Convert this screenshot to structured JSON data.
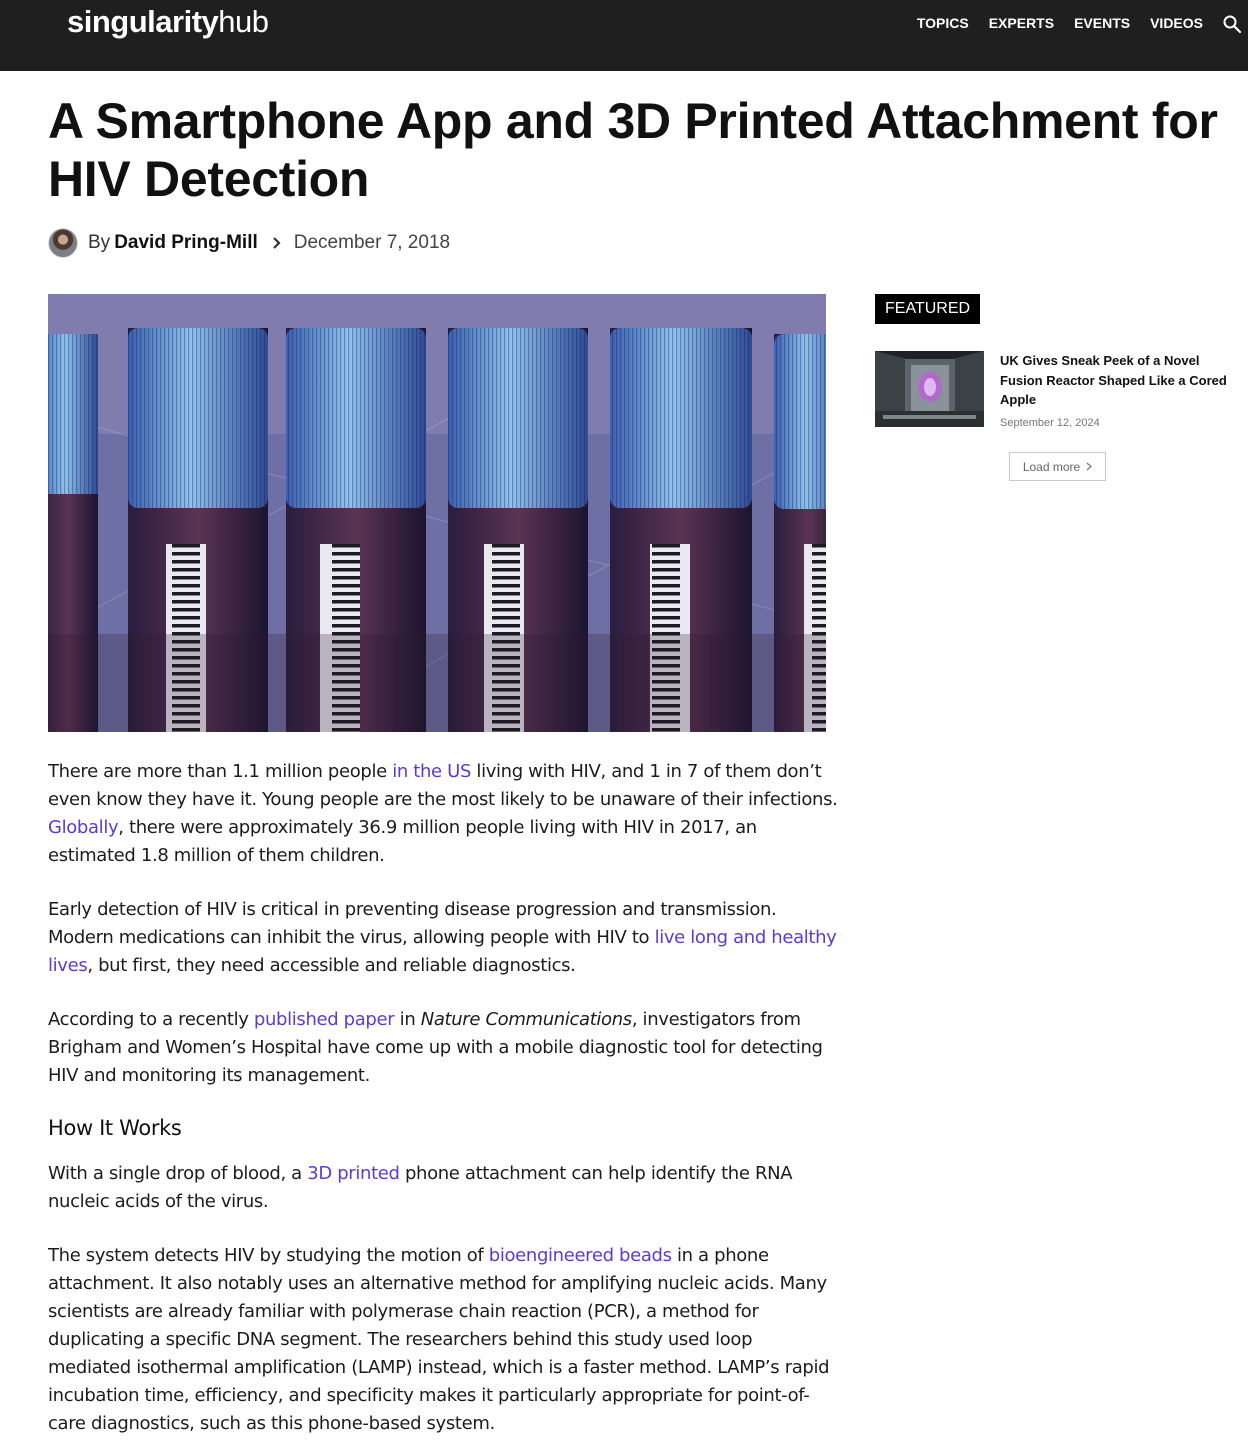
{
  "header": {
    "logo_bold": "singularity",
    "logo_light": "hub",
    "nav": [
      "TOPICS",
      "EXPERTS",
      "EVENTS",
      "VIDEOS"
    ],
    "search_icon": "search-icon"
  },
  "article": {
    "title": "A Smartphone App and 3D Printed Attachment for HIV Detection",
    "by_label": "By",
    "author": "David Pring-Mill",
    "date": "December 7, 2018",
    "p1": {
      "a": "There are more than 1.1 million people ",
      "link1": "in the US",
      "b": " living with HIV, and 1 in 7 of them don’t even know they have it. Young people are the most likely to be unaware of their infections. ",
      "link2": "Globally",
      "c": ", there were approximately 36.9 million people living with HIV in 2017, an estimated 1.8 million of them children."
    },
    "p2": {
      "a": "Early detection of HIV is critical in preventing disease progression and transmission. Modern medications can inhibit the virus, allowing people with HIV to ",
      "link1": "live long and healthy lives",
      "b": ", but first, they need accessible and reliable diagnostics."
    },
    "p3": {
      "a": "According to a recently ",
      "link1": "published paper",
      "b": " in ",
      "em": "Nature Communications",
      "c": ", investigators from Brigham and Women’s Hospital have come up with a mobile diagnostic tool for detecting HIV and monitoring its management."
    },
    "h2": "How It Works",
    "p4": {
      "a": "With a single drop of blood, a ",
      "link1": "3D printed",
      "b": " phone attachment can help identify the RNA nucleic acids of the virus."
    },
    "p5": {
      "a": "The system detects HIV by studying the motion of ",
      "link1": "bioengineered beads",
      "b": " in a phone attachment. It also notably uses an alternative method for amplifying nucleic acids. Many scientists are already familiar with polymerase chain reaction (PCR), a method for duplicating a specific DNA segment. The researchers behind this study used loop mediated isothermal amplification (LAMP) instead, which is a faster method. LAMP’s rapid incubation time, efficiency, and specificity makes it particularly appropriate for point-of-care diagnostics, such as this phone-based system."
    }
  },
  "sidebar": {
    "tag": "FEATURED",
    "item_title": "UK Gives Sneak Peek of a Novel Fusion Reactor Shaped Like a Cored Apple",
    "item_date": "September 12, 2024",
    "load_more": "Load more"
  },
  "colors": {
    "link": "#5b3bd6",
    "header_bg": "#1f1f1f"
  }
}
